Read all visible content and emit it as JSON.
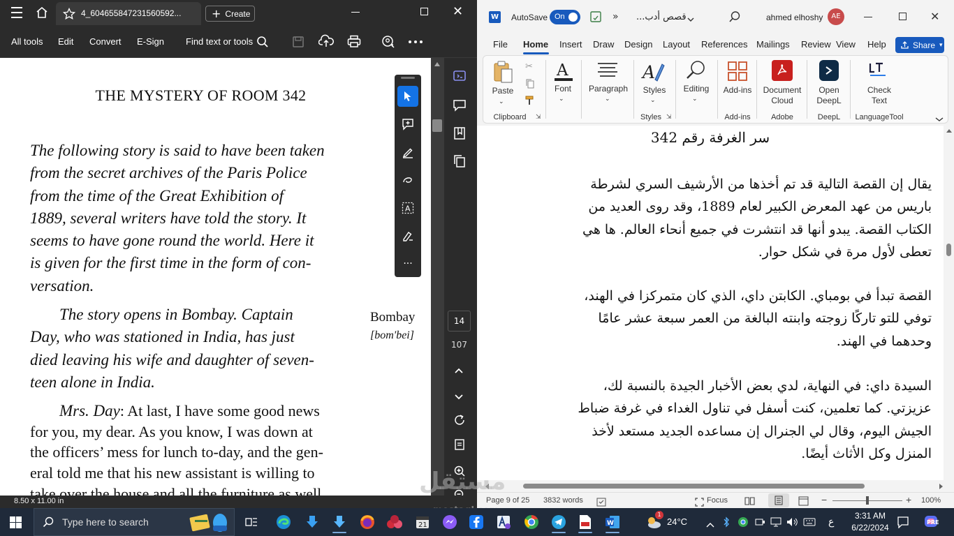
{
  "acrobat": {
    "tab_title": "4_604655847231560592...",
    "create_label": "Create",
    "toolbar": {
      "all_tools": "All tools",
      "edit": "Edit",
      "convert": "Convert",
      "esign": "E-Sign",
      "find": "Find text or tools"
    },
    "page": {
      "title": "THE MYSTERY OF ROOM 342",
      "intro_lines": [
        "The following story is said to have been taken",
        "from the secret archives of the Paris Police",
        "from the time of the Great Exhibition of",
        "1889, several writers have told the story. It",
        "seems to have gone round the world. Here it",
        "is given for the first time in the form of con-",
        "versation."
      ],
      "story_lines": [
        "The story opens in Bombay. Captain",
        "Day, who was stationed in India, has just",
        "died leaving his wife and daughter of seven-",
        "teen alone in India."
      ],
      "margin_note_word": "Bombay",
      "margin_note_pron": "[bom'bei]",
      "dialog_speaker": "Mrs. Day",
      "dialog_first": ": At last, I have some good news",
      "dialog_lines": [
        "for you, my dear. As you know, I was down at",
        "the officers’ mess for lunch to-day, and the gen-",
        "eral told me that his new assistant is willing to",
        "take over the house and all the furniture as well"
      ]
    },
    "page_current": "14",
    "page_total": "107",
    "page_size": "8.50 x 11.00 in"
  },
  "word": {
    "autosave_label": "AutoSave",
    "autosave_state": "On",
    "doc_title": "قصص أدب...",
    "user_name": "ahmed elhoshy",
    "user_initials": "AE",
    "menu": [
      "File",
      "Home",
      "Insert",
      "Draw",
      "Design",
      "Layout",
      "References",
      "Mailings",
      "Review",
      "View",
      "Help"
    ],
    "share_label": "Share",
    "ribbon": {
      "paste": "Paste",
      "clipboard": "Clipboard",
      "font": "Font",
      "paragraph": "Paragraph",
      "styles": "Styles",
      "styles_group": "Styles",
      "editing": "Editing",
      "addins": "Add-ins",
      "addins_group": "Add-ins",
      "doc_cloud_1": "Document",
      "doc_cloud_2": "Cloud",
      "adobe_group": "Adobe",
      "deepl_1": "Open",
      "deepl_2": "DeepL",
      "deepl_group": "DeepL",
      "check_1": "Check",
      "check_2": "Text",
      "language_group": "LanguageTool"
    },
    "doc": {
      "title": "سر الغرفة رقم 342",
      "p1": [
        "يقال إن القصة التالية قد تم أخذها من الأرشيف السري لشرطة",
        "باريس من عهد المعرض الكبير لعام 1889، وقد روى العديد من",
        "الكتاب القصة. يبدو أنها قد انتشرت في جميع أنحاء العالم. ها هي",
        "تعطى لأول مرة في شكل حوار."
      ],
      "p2": [
        "القصة تبدأ في بومباي. الكابتن داي، الذي كان متمركزا في الهند،",
        "توفي للتو تاركًا زوجته وابنته البالغة من العمر سبعة عشر عامًا",
        "وحدهما في الهند."
      ],
      "p3": [
        "السيدة داي: في النهاية، لدي بعض الأخبار الجيدة بالنسبة لك،",
        "عزيزتي. كما تعلمين، كنت أسفل في تناول الغداء في غرفة ضباط",
        "الجيش اليوم، وقال لي الجنرال إن مساعده الجديد مستعد لأخذ",
        "المنزل وكل الأثاث أيضًا."
      ]
    },
    "status": {
      "page": "Page 9 of 25",
      "words": "3832 words",
      "focus": "Focus",
      "zoom": "100%"
    }
  },
  "taskbar": {
    "search_placeholder": "Type here to search",
    "weather": "24°C",
    "lang": "ع",
    "time": "3:31 AM",
    "date": "6/22/2024",
    "notif_badge": "1"
  },
  "watermark": {
    "line1": "مستقل",
    "line2": "mostaql.com"
  }
}
